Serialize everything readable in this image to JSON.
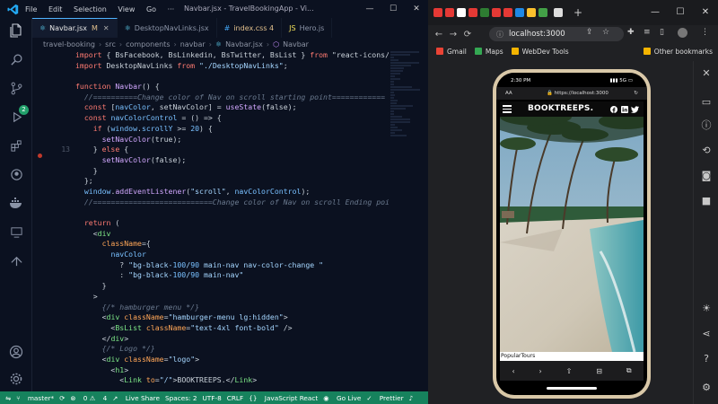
{
  "vscode": {
    "menu": [
      "File",
      "Edit",
      "Selection",
      "View",
      "Go",
      "···"
    ],
    "window_title": "Navbar.jsx - TravelBookingApp - Vi...",
    "tabs": [
      {
        "label": "Navbar.jsx",
        "modified": "M",
        "active": true
      },
      {
        "label": "DesktopNavLinks.jsx",
        "active": false
      },
      {
        "label": "index.css 4",
        "active": false
      },
      {
        "label": "Hero.js",
        "active": false
      }
    ],
    "breadcrumb": [
      "travel-booking",
      "src",
      "components",
      "navbar",
      "Navbar.jsx",
      "Navbar"
    ],
    "scm_badge": "2",
    "line_numbers": [
      "",
      "",
      "",
      "",
      "",
      "",
      "",
      "",
      "",
      "13",
      "",
      "",
      "",
      "",
      "",
      "",
      "",
      "",
      "",
      "",
      "",
      "",
      "",
      "",
      "",
      "",
      "",
      "",
      "",
      "",
      "",
      "",
      ""
    ],
    "code_lines": [
      "import { BsFacebook, BsLinkedin, BsTwitter, BsList } from \"react-icons/b",
      "import DesktopNavLinks from \"./DesktopNavLinks\";",
      "",
      "function Navbar() {",
      "  //==========Change color of Nav on scroll starting point============",
      "  const [navColor, setNavColor] = useState(false);",
      "  const navColorControl = () => {",
      "    if (window.scrollY >= 20) {",
      "      setNavColor(true);",
      "    } else {",
      "      setNavColor(false);",
      "    }",
      "  };",
      "  window.addEventListener(\"scroll\", navColorControl);",
      "  //===========================Change color of Nav on scroll Ending point",
      "",
      "  return (",
      "    <div",
      "      className={",
      "        navColor",
      "          ? \"bg-black-100/90 main-nav nav-color-change \"",
      "          : \"bg-black-100/90 main-nav\"",
      "      }",
      "    >",
      "      {/* hamburger menu */}",
      "      <div className=\"hamburger-menu lg:hidden\">",
      "        <BsList className=\"text-4xl font-bold\" />",
      "      </div>",
      "      {/* Logo */}",
      "      <div className=\"logo\">",
      "        <h1>",
      "          <Link to=\"/\">BOOKTREEPS.</Link>"
    ],
    "status": {
      "branch": "master*",
      "problems_errors": "0",
      "problems_warnings": "4",
      "live_share": "Live Share",
      "spaces": "Spaces: 2",
      "encoding": "UTF-8",
      "eol": "CRLF",
      "language": "JavaScript React",
      "go_live": "Go Live",
      "prettier": "Prettier"
    }
  },
  "browser": {
    "url": "localhost:3000",
    "bookmarks": [
      {
        "label": "Gmail",
        "color": "#ea4335"
      },
      {
        "label": "Maps",
        "color": "#34a853"
      },
      {
        "label": "WebDev Tools",
        "color": "#f4b400"
      }
    ],
    "other_bookmarks": "Other bookmarks",
    "phone": {
      "time": "2:30 PM",
      "signal": "5G",
      "aa": "AA",
      "url": "https://localhost:3000",
      "site_logo": "BOOKTREEPS.",
      "section_label": "PopularTours"
    }
  },
  "colors": {
    "accent": "#4fb3ff",
    "statusbar": "#16825d",
    "phone_frame": "#d9c8a8"
  }
}
